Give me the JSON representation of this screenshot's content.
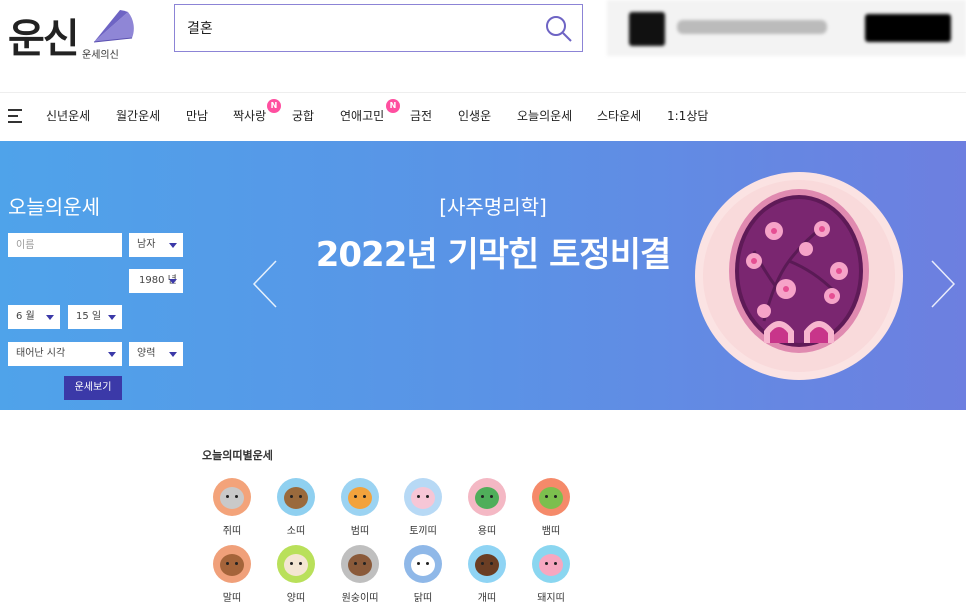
{
  "logo": {
    "text": "운신",
    "subtitle": "운세의신"
  },
  "search": {
    "value": "결혼",
    "placeholder": ""
  },
  "nav": {
    "items": [
      {
        "label": "신년운세",
        "badge": ""
      },
      {
        "label": "월간운세",
        "badge": ""
      },
      {
        "label": "만남",
        "badge": ""
      },
      {
        "label": "짝사랑",
        "badge": "N"
      },
      {
        "label": "궁합",
        "badge": ""
      },
      {
        "label": "연애고민",
        "badge": "N"
      },
      {
        "label": "금전",
        "badge": ""
      },
      {
        "label": "인생운",
        "badge": ""
      },
      {
        "label": "오늘의운세",
        "badge": ""
      },
      {
        "label": "스타운세",
        "badge": ""
      },
      {
        "label": "1:1상담",
        "badge": ""
      }
    ]
  },
  "fortune_form": {
    "title": "오늘의운세",
    "name_placeholder": "이름",
    "gender": "남자",
    "year": "1980 년",
    "month": "6 월",
    "day": "15 일",
    "birth_time": "태어난 시각",
    "calendar": "양력",
    "submit_label": "운세보기"
  },
  "banner": {
    "subtitle": "[사주명리학]",
    "title": "2022년 기막힌 토정비결"
  },
  "zodiac": {
    "title": "오늘의띠별운세",
    "items": [
      {
        "label": "쥐띠",
        "bg": "#f3a37a",
        "face": "#c9c9c9"
      },
      {
        "label": "소띠",
        "bg": "#8fd0f0",
        "face": "#9a6a3c"
      },
      {
        "label": "범띠",
        "bg": "#9bd3f2",
        "face": "#f2a23c"
      },
      {
        "label": "토끼띠",
        "bg": "#b7d9f5",
        "face": "#f6c6d6"
      },
      {
        "label": "용띠",
        "bg": "#f4b8c4",
        "face": "#4fae5a"
      },
      {
        "label": "뱀띠",
        "bg": "#f58a6a",
        "face": "#7cbf4e"
      },
      {
        "label": "말띠",
        "bg": "#f0a07a",
        "face": "#a5643a"
      },
      {
        "label": "양띠",
        "bg": "#b9e05a",
        "face": "#f4e6d2"
      },
      {
        "label": "원숭이띠",
        "bg": "#bfbfbf",
        "face": "#8a5a3a"
      },
      {
        "label": "닭띠",
        "bg": "#8fb8e8",
        "face": "#ffffff"
      },
      {
        "label": "개띠",
        "bg": "#8fd4f4",
        "face": "#6b3e24"
      },
      {
        "label": "돼지띠",
        "bg": "#8ad6f0",
        "face": "#f7a7c0"
      }
    ]
  },
  "colors": {
    "accent": "#3b39a8",
    "badge": "#ff4fa0",
    "search_border": "#8c84d6"
  }
}
